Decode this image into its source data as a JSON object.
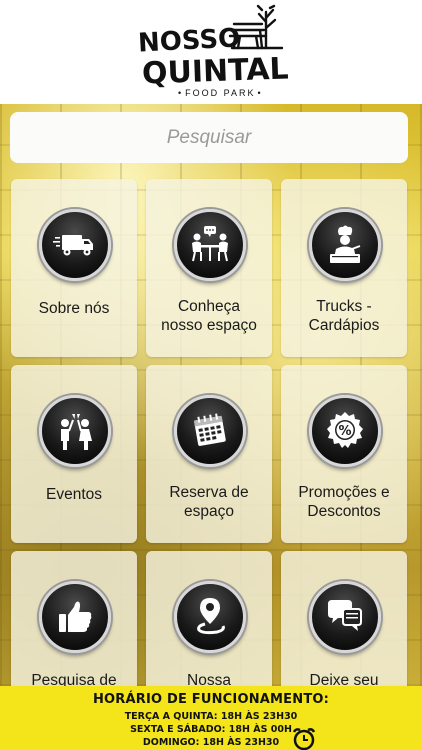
{
  "logo": {
    "line1": "NOSSO",
    "line2": "QUINTAL",
    "subtitle": "FOOD PARK"
  },
  "search": {
    "placeholder": "Pesquisar",
    "value": ""
  },
  "tiles": [
    {
      "label": "Sobre nós",
      "icon": "delivery-truck-icon"
    },
    {
      "label": "Conheça\nnosso espaço",
      "icon": "table-chat-icon"
    },
    {
      "label": "Trucks -\nCardápios",
      "icon": "chef-icon"
    },
    {
      "label": "Eventos",
      "icon": "toast-people-icon"
    },
    {
      "label": "Reserva de\nespaço",
      "icon": "calendar-icon"
    },
    {
      "label": "Promoções e\nDescontos",
      "icon": "percent-badge-icon"
    },
    {
      "label": "Pesquisa de",
      "icon": "thumbs-up-icon"
    },
    {
      "label": "Nossa",
      "icon": "map-pin-route-icon"
    },
    {
      "label": "Deixe seu",
      "icon": "speech-bubbles-icon"
    }
  ],
  "hours": {
    "title": "HORÁRIO DE FUNCIONAMENTO:",
    "line1": "TERÇA A QUINTA: 18H ÀS 23H30",
    "line2": "SEXTA E SÁBADO: 18H ÀS 00H",
    "line3": "DOMINGO: 18H ÀS 23H30"
  },
  "colors": {
    "accent_yellow": "#f3e51a",
    "tile_bg": "#f5f3e1",
    "icon_dark": "#1a1a1a"
  }
}
